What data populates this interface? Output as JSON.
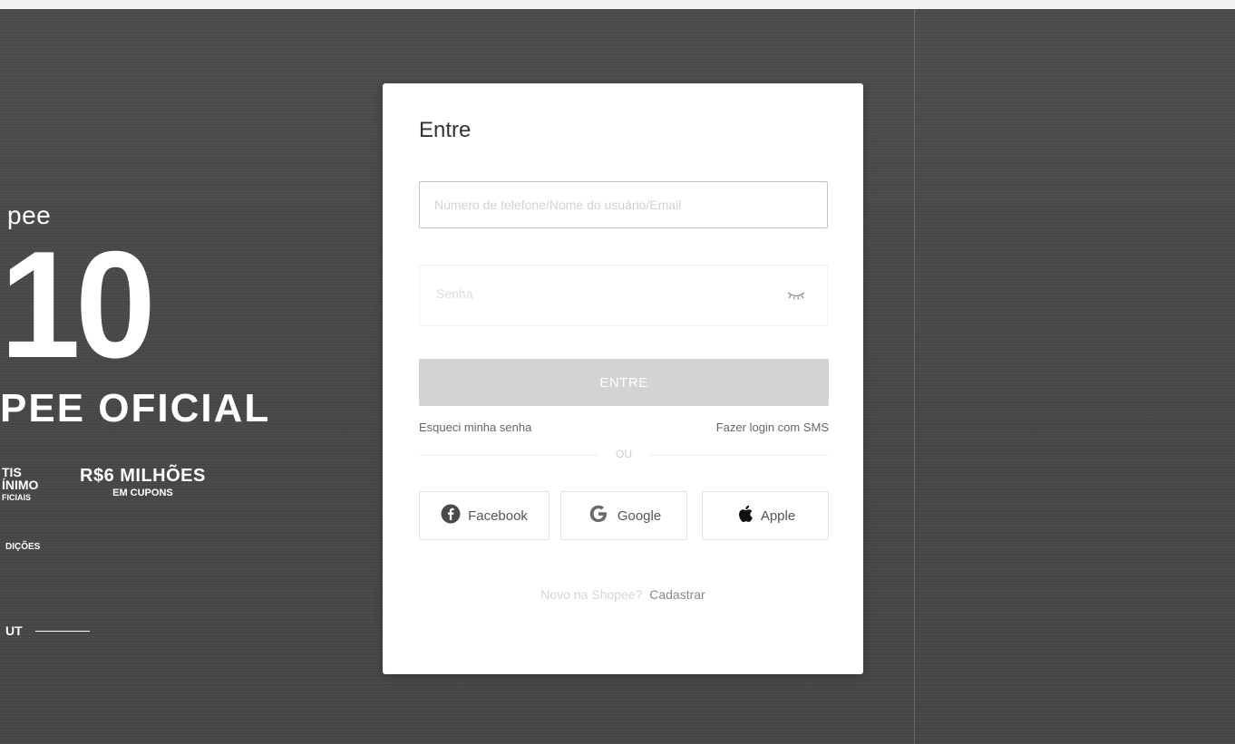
{
  "promo": {
    "brand": "pee",
    "big_number": "10",
    "title": "PEE OFICIAL",
    "left_line1": "TIS",
    "left_line2": "ÍNIMO",
    "left_line3": "FICIAIS",
    "amount": "R$6 MILHÕES",
    "amount_sub": "EM CUPONS",
    "conditions": "DIÇÕES",
    "cta": "UT"
  },
  "login": {
    "title": "Entre",
    "user_placeholder": "Número de telefone/Nome do usuário/Email",
    "password_placeholder": "Senha",
    "submit_label": "ENTRE",
    "forgot_password": "Esqueci minha senha",
    "sms_login": "Fazer login com SMS",
    "or_label": "OU",
    "social": {
      "facebook": "Facebook",
      "google": "Google",
      "apple": "Apple"
    },
    "signup_question": "Novo na Shopee?",
    "signup_link": "Cadastrar"
  },
  "icons": {
    "eye": "eye-closed-icon",
    "facebook": "facebook-icon",
    "google": "google-icon",
    "apple": "apple-icon"
  }
}
